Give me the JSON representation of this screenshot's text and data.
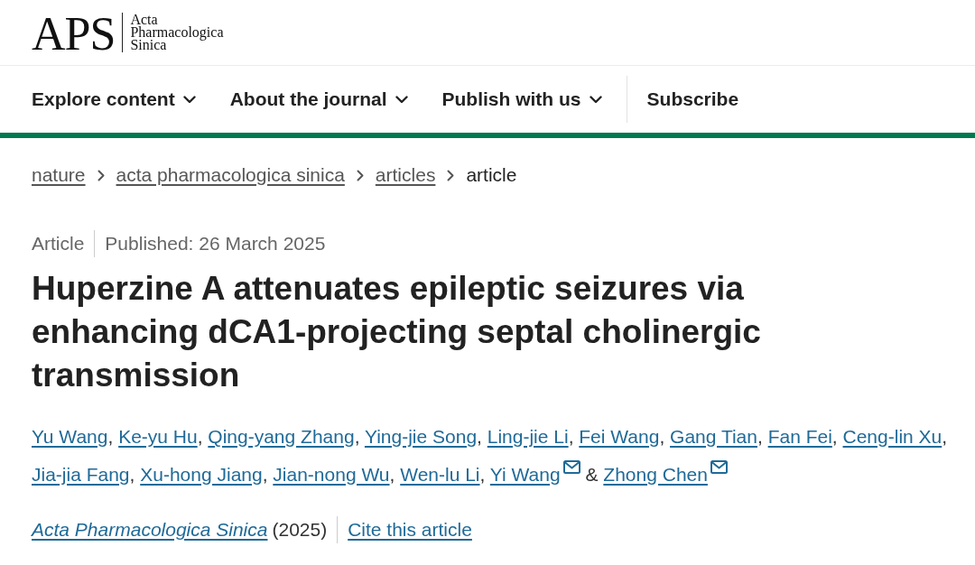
{
  "header": {
    "logo": {
      "abbreviation": "APS",
      "name_lines": [
        "Acta",
        "Pharmacologica",
        "Sinica"
      ]
    }
  },
  "nav": {
    "items": [
      {
        "label": "Explore content",
        "kind": "dropdown"
      },
      {
        "label": "About the journal",
        "kind": "dropdown"
      },
      {
        "label": "Publish with us",
        "kind": "dropdown"
      },
      {
        "label": "Subscribe",
        "kind": "link"
      }
    ]
  },
  "breadcrumbs": [
    {
      "label": "nature",
      "current": false
    },
    {
      "label": "acta pharmacologica sinica",
      "current": false
    },
    {
      "label": "articles",
      "current": false
    },
    {
      "label": "article",
      "current": true
    }
  ],
  "article": {
    "type": "Article",
    "published": "Published: 26 March 2025",
    "title": "Huperzine A attenuates epileptic seizures via enhancing dCA1-projecting septal cholinergic transmission",
    "authors": [
      {
        "name": "Yu Wang",
        "corresponding": false
      },
      {
        "name": "Ke-yu Hu",
        "corresponding": false
      },
      {
        "name": "Qing-yang Zhang",
        "corresponding": false
      },
      {
        "name": "Ying-jie Song",
        "corresponding": false
      },
      {
        "name": "Ling-jie Li",
        "corresponding": false
      },
      {
        "name": "Fei Wang",
        "corresponding": false
      },
      {
        "name": "Gang Tian",
        "corresponding": false
      },
      {
        "name": "Fan Fei",
        "corresponding": false
      },
      {
        "name": "Ceng-lin Xu",
        "corresponding": false
      },
      {
        "name": "Jia-jia Fang",
        "corresponding": false
      },
      {
        "name": "Xu-hong Jiang",
        "corresponding": false
      },
      {
        "name": "Jian-nong Wu",
        "corresponding": false
      },
      {
        "name": "Wen-lu Li",
        "corresponding": false
      },
      {
        "name": "Yi Wang",
        "corresponding": true
      },
      {
        "name": "Zhong Chen",
        "corresponding": true
      }
    ],
    "author_separator": ",",
    "final_conjunction": "&",
    "journal": "Acta Pharmacologica Sinica",
    "year": "(2025)",
    "cite_link": "Cite this article"
  }
}
